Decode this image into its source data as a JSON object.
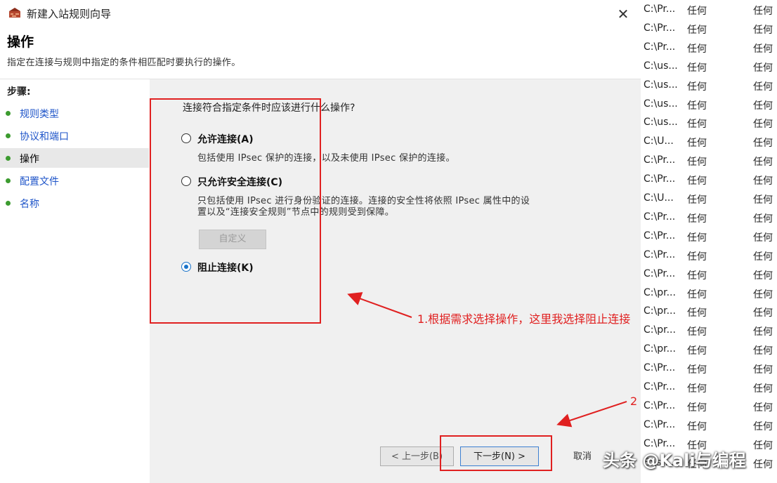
{
  "window": {
    "title": "新建入站规则向导"
  },
  "header": {
    "title": "操作",
    "description": "指定在连接与规则中指定的条件相匹配时要执行的操作。"
  },
  "steps": {
    "label": "步骤:",
    "items": [
      {
        "label": "规则类型",
        "current": false
      },
      {
        "label": "协议和端口",
        "current": false
      },
      {
        "label": "操作",
        "current": true
      },
      {
        "label": "配置文件",
        "current": false
      },
      {
        "label": "名称",
        "current": false
      }
    ]
  },
  "content": {
    "question": "连接符合指定条件时应该进行什么操作?",
    "options": [
      {
        "label": "允许连接(A)",
        "desc": [
          "包括使用 IPsec 保护的连接，以及未使用 IPsec 保护的连接。"
        ],
        "selected": false
      },
      {
        "label": "只允许安全连接(C)",
        "desc": [
          "只包括使用 IPsec 进行身份验证的连接。连接的安全性将依照 IPsec 属性中的设",
          "置以及“连接安全规则”节点中的规则受到保障。"
        ],
        "selected": false
      },
      {
        "label": "阻止连接(K)",
        "desc": [],
        "selected": true
      }
    ],
    "customize_label": "自定义"
  },
  "buttons": {
    "back": "< 上一步(B)",
    "next": "下一步(N) >",
    "cancel": "取消"
  },
  "annotations": {
    "note1": "1.根据需求选择操作，这里我选择阻止连接",
    "note2": "2",
    "color": "#e02020"
  },
  "watermark": "头条 @Kali与编程",
  "background_list": {
    "rows": [
      [
        "C:\\Pr...",
        "任何",
        "任何"
      ],
      [
        "C:\\Pr...",
        "任何",
        "任何"
      ],
      [
        "C:\\Pr...",
        "任何",
        "任何"
      ],
      [
        "C:\\us...",
        "任何",
        "任何"
      ],
      [
        "C:\\us...",
        "任何",
        "任何"
      ],
      [
        "C:\\us...",
        "任何",
        "任何"
      ],
      [
        "C:\\us...",
        "任何",
        "任何"
      ],
      [
        "C:\\U...",
        "任何",
        "任何"
      ],
      [
        "C:\\Pr...",
        "任何",
        "任何"
      ],
      [
        "C:\\Pr...",
        "任何",
        "任何"
      ],
      [
        "C:\\U...",
        "任何",
        "任何"
      ],
      [
        "C:\\Pr...",
        "任何",
        "任何"
      ],
      [
        "C:\\Pr...",
        "任何",
        "任何"
      ],
      [
        "C:\\Pr...",
        "任何",
        "任何"
      ],
      [
        "C:\\Pr...",
        "任何",
        "任何"
      ],
      [
        "C:\\pr...",
        "任何",
        "任何"
      ],
      [
        "C:\\pr...",
        "任何",
        "任何"
      ],
      [
        "C:\\pr...",
        "任何",
        "任何"
      ],
      [
        "C:\\pr...",
        "任何",
        "任何"
      ],
      [
        "C:\\Pr...",
        "任何",
        "任何"
      ],
      [
        "C:\\Pr...",
        "任何",
        "任何"
      ],
      [
        "C:\\Pr...",
        "任何",
        "任何"
      ],
      [
        "C:\\Pr...",
        "任何",
        "任何"
      ],
      [
        "C:\\Pr...",
        "任何",
        "任何"
      ],
      [
        "E:\\sh...",
        "任何",
        "任何"
      ]
    ]
  }
}
